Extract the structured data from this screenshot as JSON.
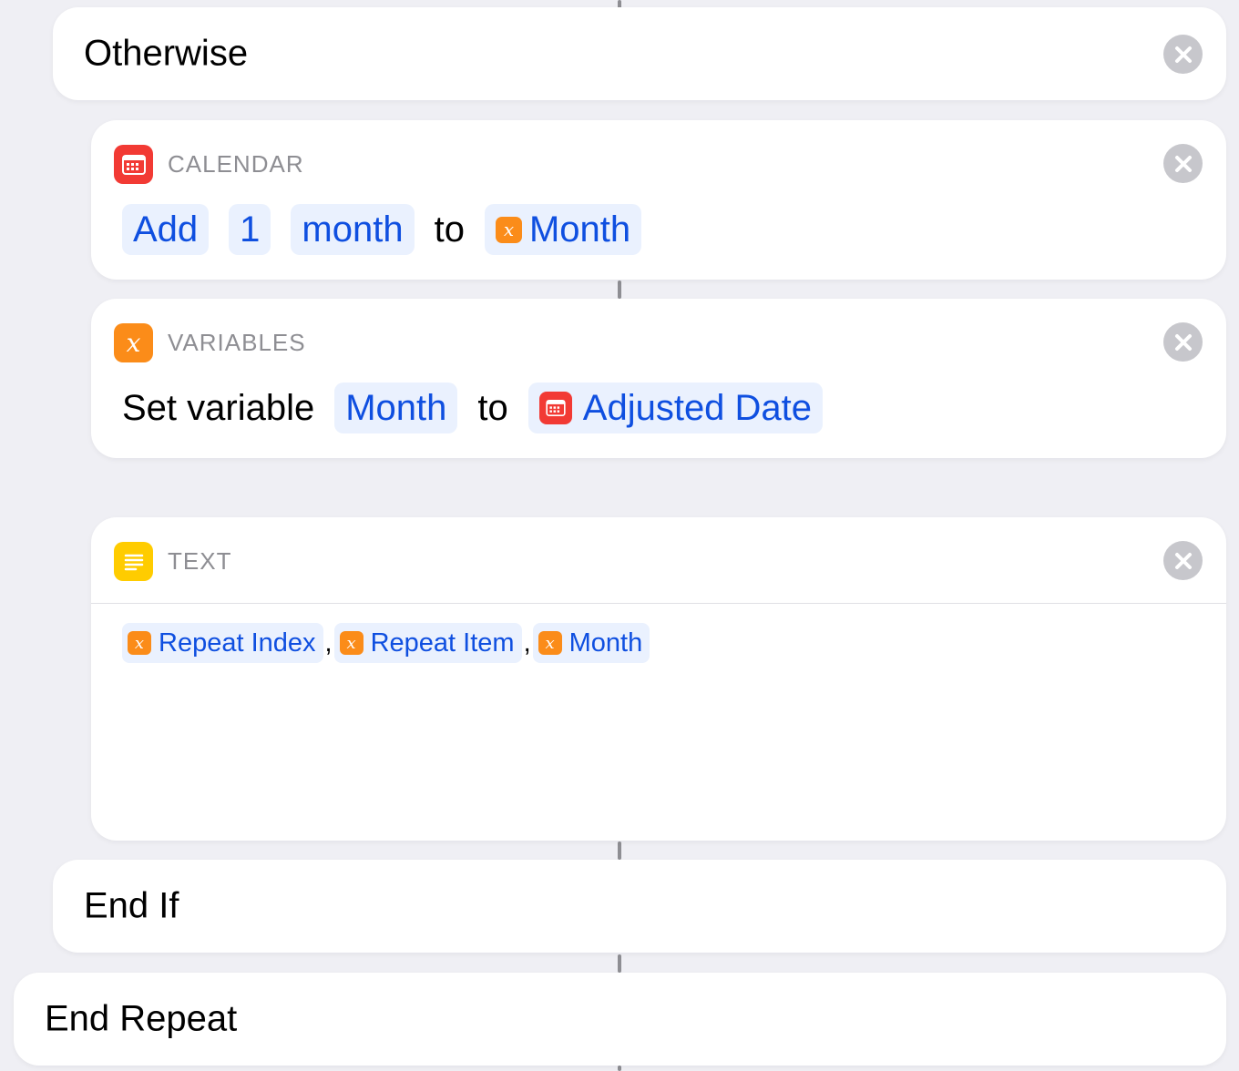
{
  "otherwise": {
    "title": "Otherwise"
  },
  "calendar_action": {
    "app_name": "CALENDAR",
    "verb": "Add",
    "amount": "1",
    "unit": "month",
    "connector": "to",
    "target_variable": "Month"
  },
  "variables_action": {
    "app_name": "VARIABLES",
    "label": "Set variable",
    "variable": "Month",
    "connector": "to",
    "value": "Adjusted Date"
  },
  "text_action": {
    "app_name": "TEXT",
    "tokens": [
      "Repeat Index",
      "Repeat Item",
      "Month"
    ],
    "separator": ","
  },
  "end_if": {
    "title": "End If"
  },
  "end_repeat": {
    "title": "End Repeat"
  },
  "icons": {
    "close": "close-icon",
    "calendar": "calendar-icon",
    "variable": "variable-x-icon",
    "text": "text-lines-icon"
  },
  "colors": {
    "background": "#efeff4",
    "token_text": "#0f4fe0",
    "token_bg": "#eaf1fe",
    "calendar": "#f23a34",
    "variables": "#fb8c19",
    "text": "#ffcc00"
  }
}
